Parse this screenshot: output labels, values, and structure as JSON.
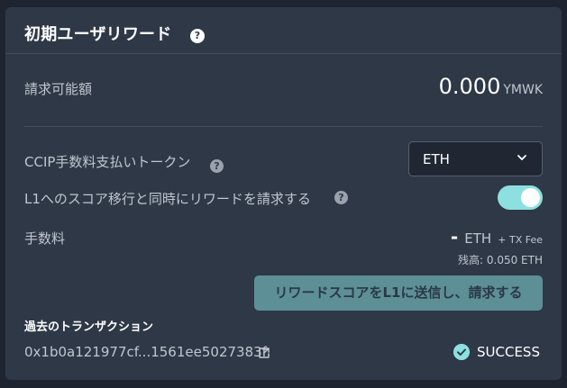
{
  "title": "初期ユーザリワード",
  "claim": {
    "label": "請求可能額",
    "amount": "0.000",
    "unit": "YMWK"
  },
  "ccip": {
    "label": "CCIP手数料支払いトークン",
    "selected": "ETH"
  },
  "l1_option": {
    "label": "L1へのスコア移行と同時にリワードを請求する",
    "enabled": true
  },
  "fee": {
    "label": "手数料",
    "value": "-",
    "unit": "ETH",
    "suffix": "+ TX Fee",
    "balance": "残高: 0.050 ETH"
  },
  "submit_label": "リワードスコアをL1に送信し、請求する",
  "transactions": {
    "heading": "過去のトランザクション",
    "hash": "0x1b0a121977cf...1561ee5027383f",
    "status": "SUCCESS"
  },
  "colors": {
    "accent": "#8de0e0",
    "panel": "#2e3847",
    "background": "#1f2530",
    "button": "#5d8f96"
  },
  "icons": {
    "help": "question-circle-icon",
    "dropdown": "chevron-down-icon",
    "external": "external-link-icon",
    "status": "check-circle-icon"
  }
}
